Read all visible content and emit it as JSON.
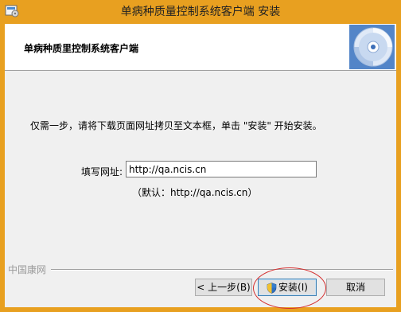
{
  "window": {
    "title": "单病种质量控制系统客户端 安装"
  },
  "header": {
    "title": "单病种质里控制系统客户端"
  },
  "main": {
    "instruction": "仅需一步，请将下载页面网址拷贝至文本框，单击 \"安装\" 开始安装。",
    "url_label": "填写网址:",
    "url_value": "http://qa.ncis.cn",
    "default_hint": "（默认：http://qa.ncis.cn）"
  },
  "footer": {
    "brand": "中国康网",
    "back_label": "< 上一步(B)",
    "install_label": "安装(I)",
    "cancel_label": "取消"
  },
  "colors": {
    "titlebar": "#e8a020",
    "header_bg": "#ffffff",
    "dialog_bg": "#f0f0f0",
    "highlight": "#d43030"
  },
  "icons": {
    "app": "installer-icon",
    "header": "cd-disc-icon",
    "install_button": "uac-shield-icon"
  }
}
